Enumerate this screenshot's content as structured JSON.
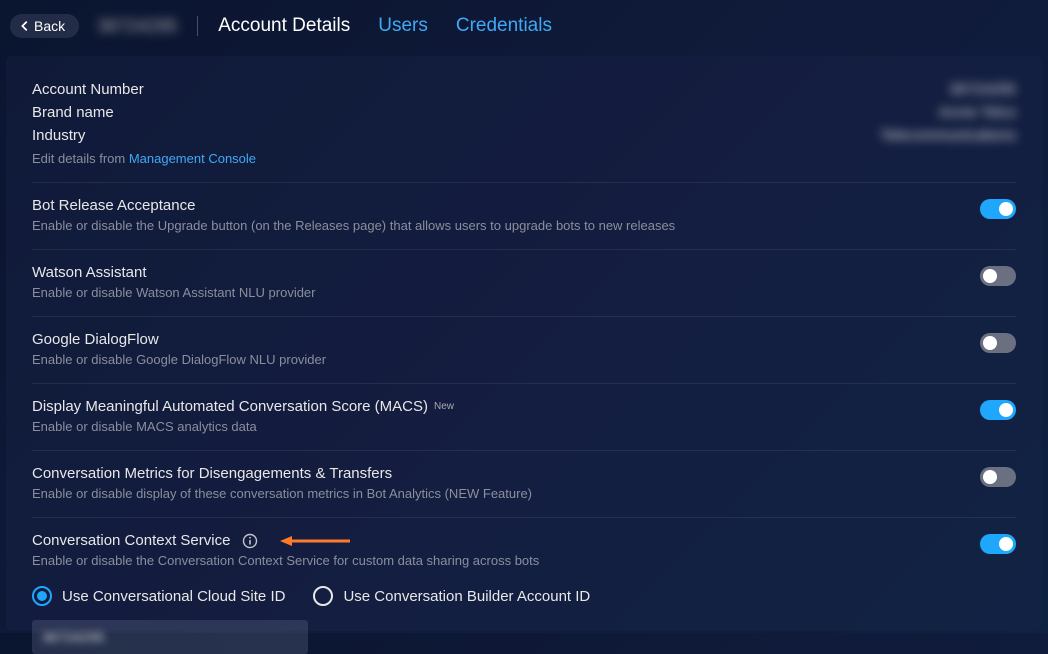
{
  "topbar": {
    "back_label": "Back",
    "account_id": "36724295",
    "tabs": [
      {
        "label": "Account Details",
        "active": true
      },
      {
        "label": "Users",
        "active": false
      },
      {
        "label": "Credentials",
        "active": false
      }
    ]
  },
  "info": {
    "account_number_label": "Account Number",
    "account_number_value": "36724295",
    "brand_label": "Brand name",
    "brand_value": "Acme Telco",
    "industry_label": "Industry",
    "industry_value": "Telecommunications",
    "edit_prefix": "Edit details from ",
    "edit_link": "Management Console"
  },
  "settings": [
    {
      "title": "Bot Release Acceptance",
      "desc": "Enable or disable the Upgrade button (on the Releases page) that allows users to upgrade bots to new releases",
      "on": true,
      "name": "bot-release-acceptance"
    },
    {
      "title": "Watson Assistant",
      "desc": "Enable or disable Watson Assistant NLU provider",
      "on": false,
      "name": "watson-assistant"
    },
    {
      "title": "Google DialogFlow",
      "desc": "Enable or disable Google DialogFlow NLU provider",
      "on": false,
      "name": "google-dialogflow"
    },
    {
      "title": "Display Meaningful Automated Conversation Score (MACS)",
      "badge": "New",
      "desc": "Enable or disable MACS analytics data",
      "on": true,
      "name": "macs"
    },
    {
      "title": "Conversation Metrics for Disengagements & Transfers",
      "desc": "Enable or disable display of these conversation metrics in Bot Analytics (NEW Feature)",
      "on": false,
      "name": "conversation-metrics"
    },
    {
      "title": "Conversation Context Service",
      "desc": "Enable or disable the Conversation Context Service for custom data sharing across bots",
      "on": true,
      "info_icon": true,
      "arrow": true,
      "name": "conversation-context-service"
    }
  ],
  "radios": {
    "opt1": "Use Conversational Cloud Site ID",
    "opt2": "Use Conversation Builder Account ID",
    "selected": 0
  },
  "input_value": "36724295"
}
